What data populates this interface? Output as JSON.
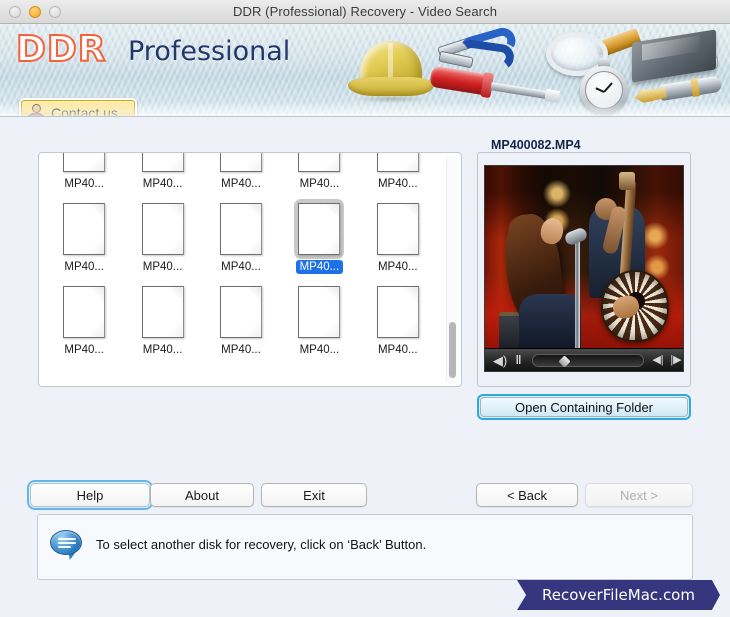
{
  "window": {
    "title": "DDR (Professional) Recovery - Video Search",
    "controls": {
      "close": "close-button",
      "minimize": "minimize-button",
      "zoom": "zoom-button"
    }
  },
  "banner": {
    "logo_primary": "DDR",
    "logo_secondary": "Professional",
    "contact_button": "Contact us",
    "accent_orange": "#f4613a",
    "accent_navy": "#22386b",
    "tool_icons": [
      "hard-hat-icon",
      "pliers-icon",
      "screwdriver-icon",
      "magnifying-glass-icon",
      "stopwatch-icon",
      "book-icon",
      "pen-icon"
    ]
  },
  "file_list": {
    "selected_index": 8,
    "items": [
      {
        "label": "MP40...",
        "clipped": true
      },
      {
        "label": "MP40...",
        "clipped": true
      },
      {
        "label": "MP40...",
        "clipped": true
      },
      {
        "label": "MP40...",
        "clipped": true
      },
      {
        "label": "MP40...",
        "clipped": true
      },
      {
        "label": "MP40...",
        "clipped": false
      },
      {
        "label": "MP40...",
        "clipped": false
      },
      {
        "label": "MP40...",
        "clipped": false
      },
      {
        "label": "MP40...",
        "clipped": false
      },
      {
        "label": "MP40...",
        "clipped": false
      },
      {
        "label": "MP40...",
        "clipped": false
      },
      {
        "label": "MP40...",
        "clipped": false
      },
      {
        "label": "MP40...",
        "clipped": false
      },
      {
        "label": "MP40...",
        "clipped": false
      },
      {
        "label": "MP40...",
        "clipped": false
      }
    ],
    "selection_color": "#1d72e8",
    "scrollbar": {
      "name": "vertical-scrollbar",
      "thumb_position": "bottom"
    }
  },
  "preview": {
    "legend": "MP400082.MP4",
    "media_type": "video",
    "controls": {
      "volume": "◀)",
      "pause": "‖",
      "step_back": "◀|",
      "step_forward": "|▶"
    },
    "open_folder_button": "Open Containing Folder",
    "focus_ring_color": "#2ea8e0"
  },
  "buttons": {
    "help": "Help",
    "about": "About",
    "exit": "Exit",
    "back": "< Back",
    "next": "Next >"
  },
  "status": {
    "icon": "speech-bubble-icon",
    "message": "To select another disk for recovery, click on ‘Back’ Button."
  },
  "brand": {
    "ribbon_text": "RecoverFileMac.com",
    "ribbon_color": "#36367f"
  }
}
